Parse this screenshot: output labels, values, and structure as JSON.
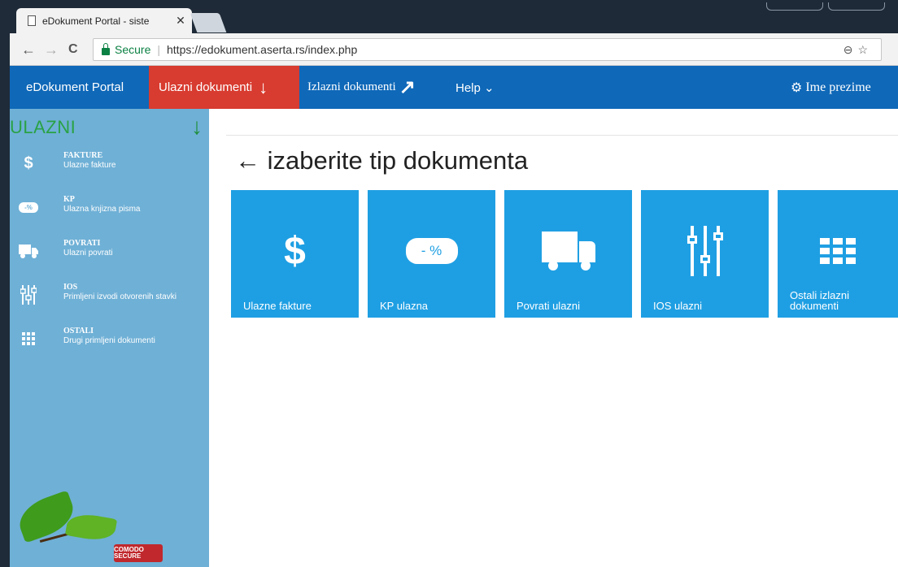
{
  "browser": {
    "tab_title": "eDokument Portal - siste",
    "tab_close": "✕",
    "back": "←",
    "forward": "→",
    "reload": "C",
    "secure_label": "Secure",
    "url": "https://edokument.aserta.rs/index.php",
    "zoom_icon": "⊖",
    "star_icon": "☆"
  },
  "appnav": {
    "brand": "eDokument Portal",
    "active": "Ulazni dokumenti",
    "active_arrow": "↓",
    "outgoing": "Izlazni dokumenti",
    "outgoing_arrow": "↗",
    "help": "Help ⌄",
    "user_gear": "⚙",
    "user": "Ime prezime"
  },
  "sidebar": {
    "title": "ULAZNI",
    "arrow": "↓",
    "items": [
      {
        "name": "FAKTURE",
        "desc": "Ulazne fakture",
        "icon_text": "$"
      },
      {
        "name": "KP",
        "desc": "Ulazna knjizna pisma",
        "icon_text": "-%"
      },
      {
        "name": "POVRATI",
        "desc": "Ulazni povrati"
      },
      {
        "name": "IOS",
        "desc": "Primljeni izvodi otvorenih stavki"
      },
      {
        "name": "OSTALI",
        "desc": "Drugi primljeni dokumenti"
      }
    ],
    "badge": "COMODO SECURE"
  },
  "main": {
    "heading": "← izaberite tip dokumenta",
    "tiles": [
      {
        "label": "Ulazne fakture",
        "icon_text": "$"
      },
      {
        "label": "KP ulazna",
        "icon_text": "- %"
      },
      {
        "label": "Povrati ulazni"
      },
      {
        "label": "IOS ulazni"
      },
      {
        "label": "Ostali izlazni dokumenti"
      }
    ]
  },
  "colors": {
    "appnav": "#0f68b8",
    "active_nav": "#d83b2f",
    "sidebar": "#6fb0d6",
    "tile": "#1f9fe3",
    "sidebar_title": "#2aa245"
  }
}
